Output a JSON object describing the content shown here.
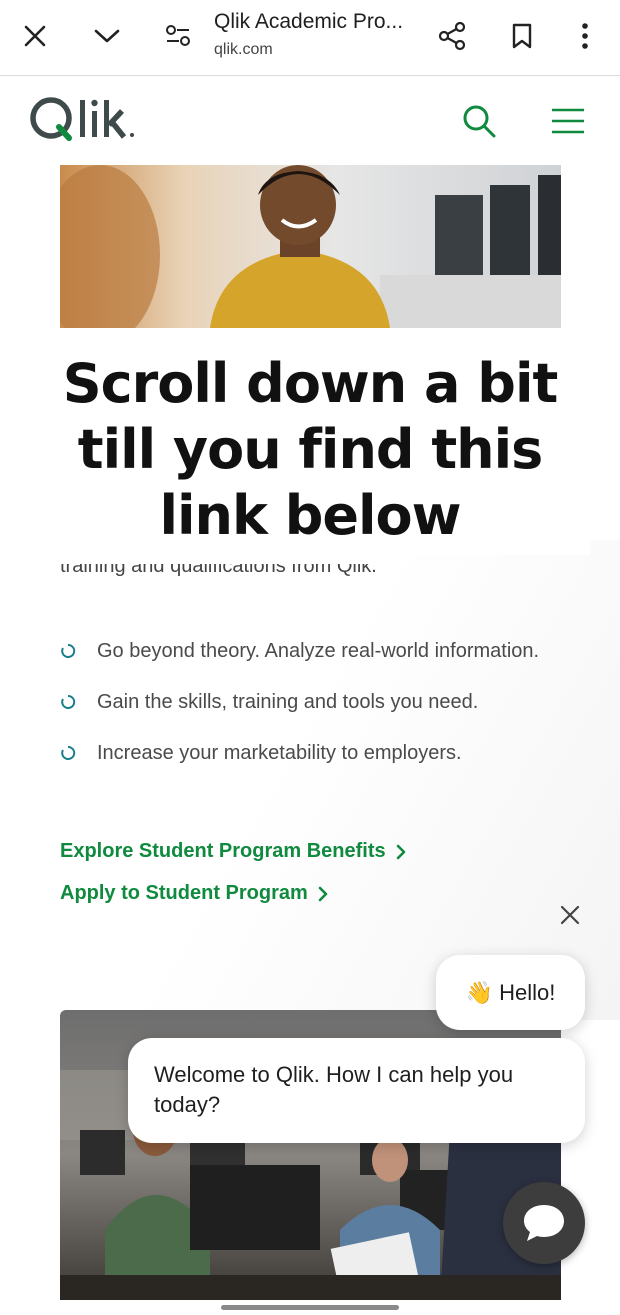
{
  "browser": {
    "title": "Qlik Academic Pro...",
    "url": "qlik.com",
    "icons": [
      "close-icon",
      "chevron-down-icon",
      "site-settings-icon",
      "share-icon",
      "bookmark-icon",
      "more-vert-icon"
    ]
  },
  "site": {
    "logo_text": "Qlik",
    "icons": [
      "search-icon",
      "hamburger-menu-icon"
    ],
    "brand_color": "#0f8a3e"
  },
  "overlay_caption": "Scroll down a bit till you find this link below",
  "partial_text": "training and qualifications from Qlik.",
  "bullets": [
    {
      "text": "Go beyond theory. Analyze real-world information."
    },
    {
      "text": "Gain the skills, training and tools you need."
    },
    {
      "text": "Increase your marketability to employers."
    }
  ],
  "links": {
    "explore": "Explore Student Program Benefits",
    "apply": "Apply to Student Program"
  },
  "chat": {
    "hello_emoji": "👋",
    "hello": "Hello!",
    "welcome": "Welcome to Qlik. How I can help you today?",
    "fab_icon": "chat-bubble-icon"
  }
}
